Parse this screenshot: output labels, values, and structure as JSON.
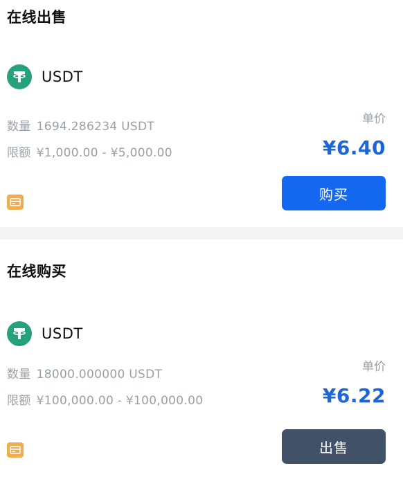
{
  "sell_section": {
    "title": "在线出售",
    "coin": "USDT",
    "quantity_label": "数量",
    "quantity_value": "1694.286234 USDT",
    "limit_label": "限额",
    "limit_value": "¥1,000.00 - ¥5,000.00",
    "unit_price_label": "单价",
    "price": "¥6.40",
    "button_label": "购买",
    "colors": {
      "button": "#1468f0",
      "price": "#1d66d9"
    }
  },
  "buy_section": {
    "title": "在线购买",
    "coin": "USDT",
    "quantity_label": "数量",
    "quantity_value": "18000.000000 USDT",
    "limit_label": "限额",
    "limit_value": "¥100,000.00 - ¥100,000.00",
    "unit_price_label": "单价",
    "price": "¥6.22",
    "button_label": "出售",
    "colors": {
      "button": "#415168",
      "price": "#1d66d9"
    }
  },
  "icons": {
    "coin": "tether-icon",
    "payment": "bank-card-icon"
  }
}
